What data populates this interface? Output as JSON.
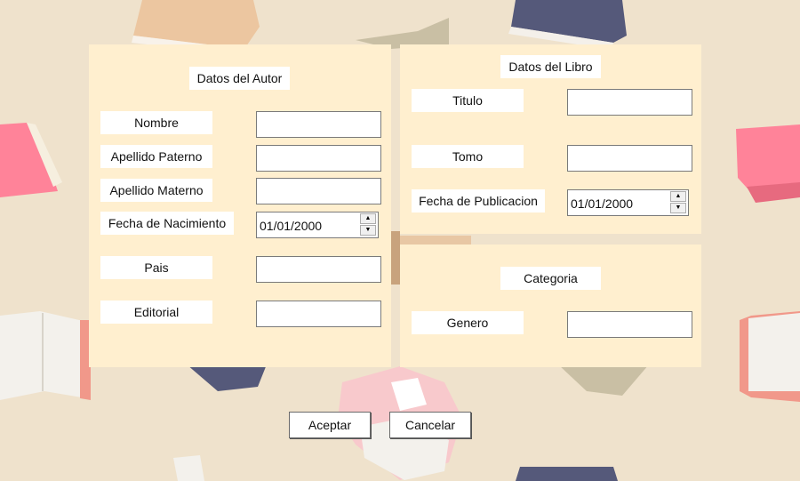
{
  "author": {
    "header": "Datos del Autor",
    "fields": [
      {
        "label": "Nombre",
        "value": ""
      },
      {
        "label": "Apellido Paterno",
        "value": ""
      },
      {
        "label": "Apellido Materno",
        "value": ""
      },
      {
        "label": "Fecha de Nacimiento",
        "value": "01/01/2000"
      },
      {
        "label": "Pais",
        "value": ""
      },
      {
        "label": "Editorial",
        "value": ""
      }
    ]
  },
  "book": {
    "header": "Datos del Libro",
    "fields": [
      {
        "label": "Titulo",
        "value": ""
      },
      {
        "label": "Tomo",
        "value": ""
      },
      {
        "label": "Fecha de Publicacion",
        "value": "01/01/2000"
      }
    ]
  },
  "category": {
    "header": "Categoria",
    "fields": [
      {
        "label": "Genero",
        "value": ""
      }
    ]
  },
  "actions": {
    "accept_label": "Aceptar",
    "cancel_label": "Cancelar"
  },
  "spinner": {
    "up": "▲",
    "down": "▼"
  },
  "colors": {
    "background": "#efe2cc",
    "panel": "#ffefcf",
    "book_navy": "#55597a",
    "book_pink": "#ff8399",
    "book_tan": "#e8c7a4"
  }
}
